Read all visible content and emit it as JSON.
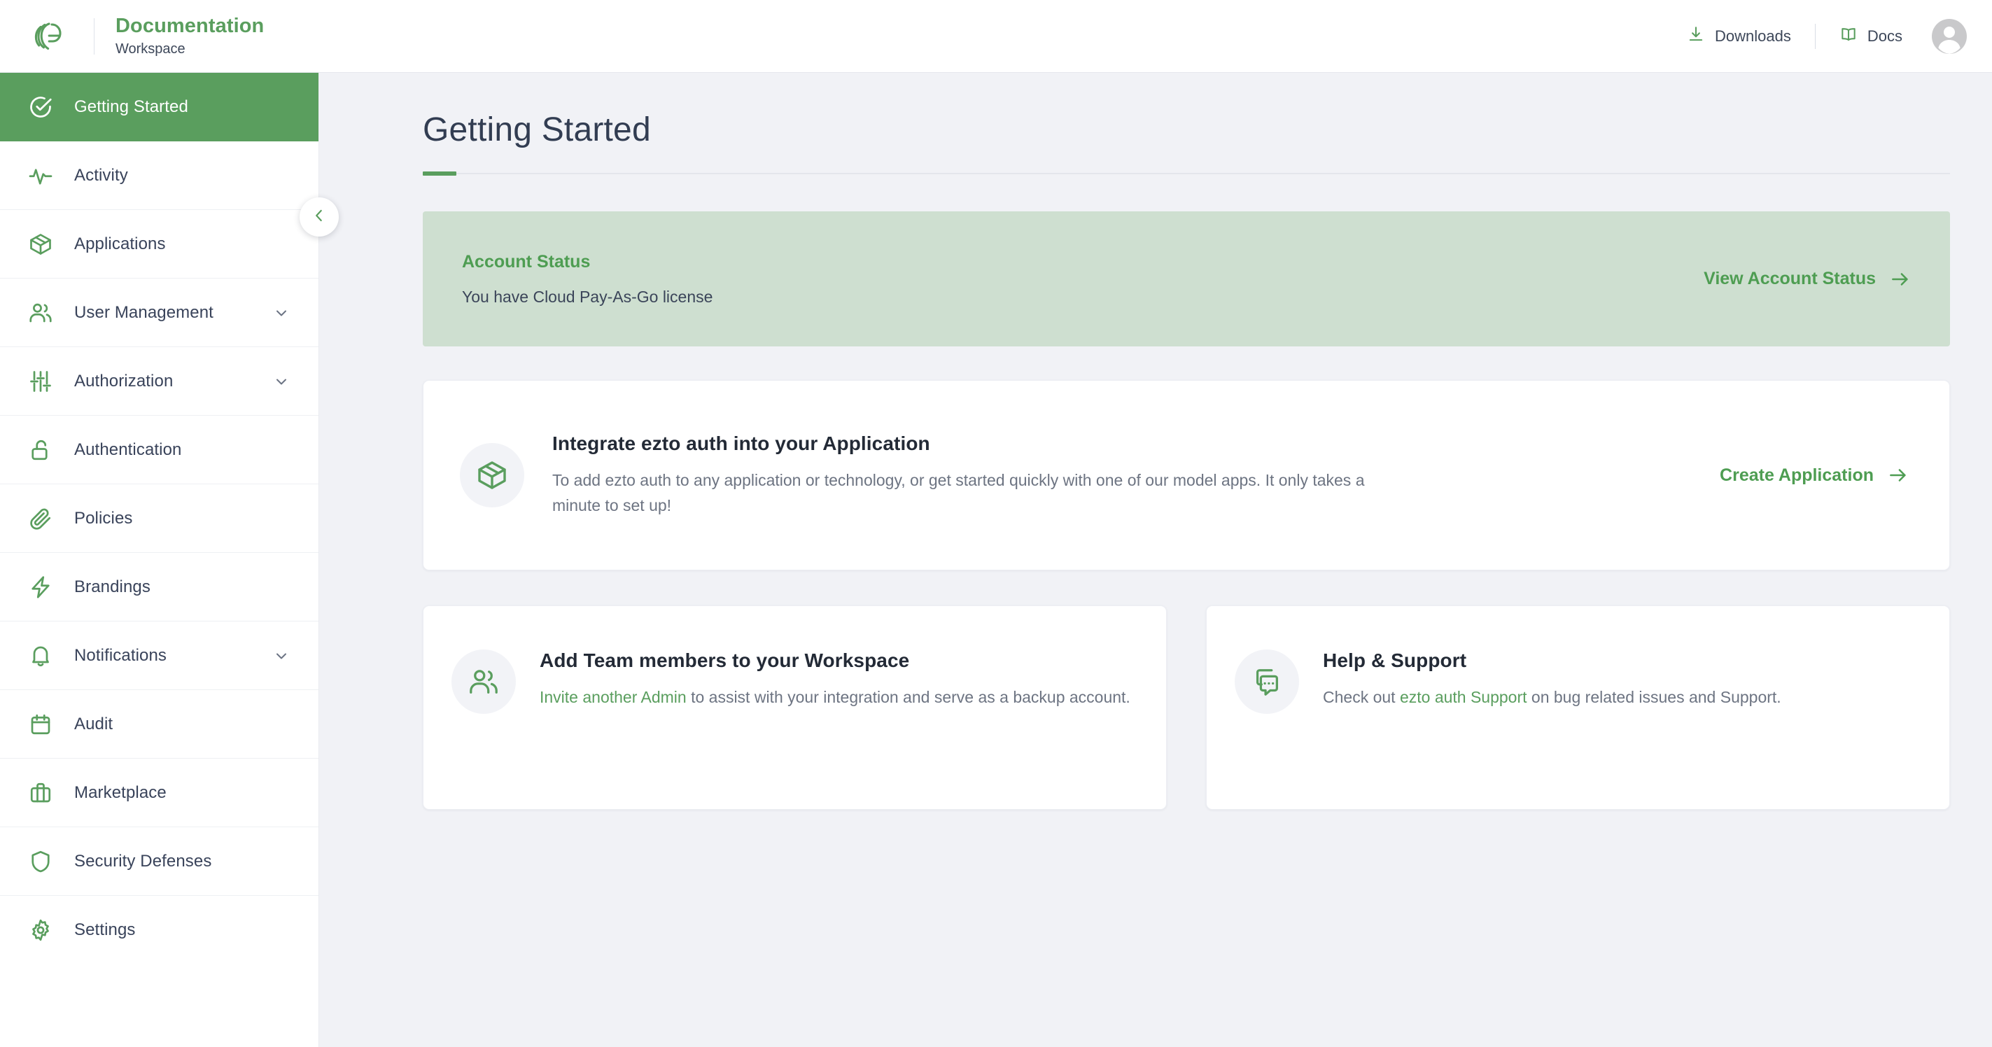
{
  "header": {
    "logo_icon": "ezto-logo-icon",
    "brand_title": "Documentation",
    "brand_subtitle": "Workspace",
    "downloads_label": "Downloads",
    "downloads_icon": "download-icon",
    "docs_label": "Docs",
    "docs_icon": "book-icon",
    "avatar_icon": "user-avatar-icon"
  },
  "sidebar": {
    "collapse_icon": "chevron-left-icon",
    "items": [
      {
        "label": "Getting Started",
        "icon": "check-circle-icon",
        "active": true,
        "expandable": false
      },
      {
        "label": "Activity",
        "icon": "activity-pulse-icon",
        "active": false,
        "expandable": false
      },
      {
        "label": "Applications",
        "icon": "package-box-icon",
        "active": false,
        "expandable": false
      },
      {
        "label": "User Management",
        "icon": "users-icon",
        "active": false,
        "expandable": true
      },
      {
        "label": "Authorization",
        "icon": "sliders-icon",
        "active": false,
        "expandable": true
      },
      {
        "label": "Authentication",
        "icon": "unlock-padlock-icon",
        "active": false,
        "expandable": false
      },
      {
        "label": "Policies",
        "icon": "paperclip-icon",
        "active": false,
        "expandable": false
      },
      {
        "label": "Brandings",
        "icon": "lightning-bolt-icon",
        "active": false,
        "expandable": false
      },
      {
        "label": "Notifications",
        "icon": "bell-icon",
        "active": false,
        "expandable": true
      },
      {
        "label": "Audit",
        "icon": "calendar-icon",
        "active": false,
        "expandable": false
      },
      {
        "label": "Marketplace",
        "icon": "briefcase-icon",
        "active": false,
        "expandable": false
      },
      {
        "label": "Security Defenses",
        "icon": "shield-icon",
        "active": false,
        "expandable": false
      },
      {
        "label": "Settings",
        "icon": "gear-icon",
        "active": false,
        "expandable": false
      }
    ]
  },
  "main": {
    "page_title": "Getting Started",
    "status_banner": {
      "title": "Account Status",
      "description": "You have Cloud Pay-As-Go license",
      "link_label": "View Account Status",
      "link_icon": "arrow-right-icon"
    },
    "integration_card": {
      "icon": "package-box-icon",
      "title": "Integrate ezto auth into your Application",
      "text": "To add ezto auth to any application or technology, or get started quickly with one of our model apps. It only takes a minute to set up!",
      "link_label": "Create Application",
      "link_icon": "arrow-right-icon"
    },
    "team_card": {
      "icon": "users-icon",
      "title": "Add Team members to your Workspace",
      "link_text": "Invite another Admin",
      "text_rest": " to assist with your integration and serve as a backup account."
    },
    "support_card": {
      "icon": "chat-support-icon",
      "title": "Help & Support",
      "text_before": "Check out ",
      "link_text": "ezto auth Support",
      "text_after": " on bug related issues and Support."
    }
  },
  "colors": {
    "brand_green": "#5a9e5e",
    "banner_bg": "#cedfd0",
    "page_bg": "#f1f2f6",
    "text_dark": "#39435a",
    "text_muted": "#6d7482"
  }
}
